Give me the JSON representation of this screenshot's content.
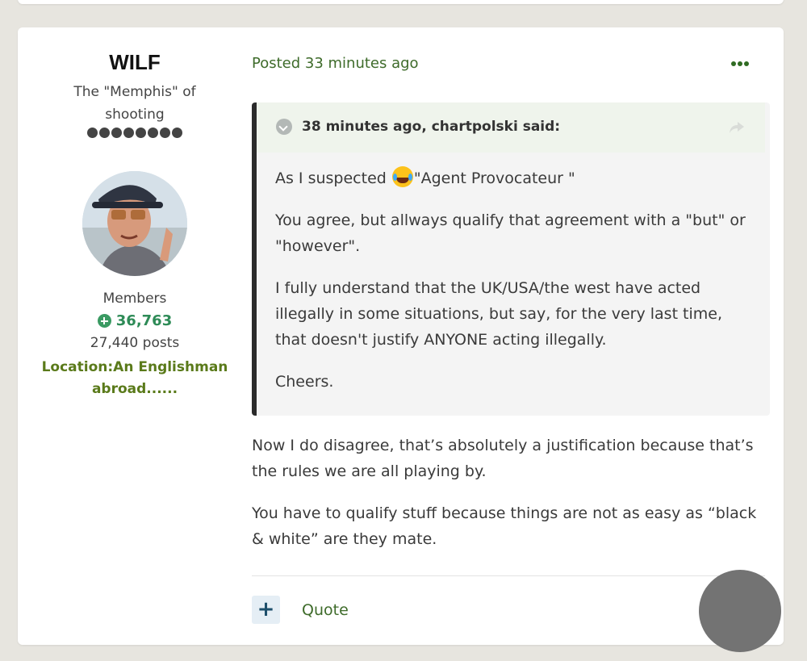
{
  "author": {
    "name": "WILF",
    "title": "The \"Memphis\" of shooting",
    "rank_dots": 8,
    "group": "Members",
    "reputation": "36,763",
    "post_count": "27,440 posts",
    "location": "Location:An Englishman abroad......"
  },
  "post": {
    "posted": "Posted 33 minutes ago",
    "quote": {
      "citation": "38 minutes ago, chartpolski said:",
      "para1_before": "As I suspected ",
      "para1_after": "\"Agent Provocateur \"",
      "para2": "You agree, but allways qualify that agreement with a \"but\" or \"however\".",
      "para3": "I fully understand that the UK/USA/the west have acted illegally in some situations, but say, for the very last time, that doesn't justify ANYONE  acting illegally.",
      "para4": "Cheers."
    },
    "body_para1": "Now I do disagree, that’s absolutely a justification because that’s the rules we are all playing by.",
    "body_para2": "You have to qualify stuff because things are not as easy as “black & white” are they mate.",
    "actions": {
      "plus_label": "+",
      "quote_label": "Quote"
    }
  },
  "icons": {
    "menu": "ellipsis-icon",
    "quote_toggle": "chevron-down-icon",
    "share": "share-arrow-icon",
    "reputation": "plus-circle-icon",
    "emoji": "tears-of-joy-emoji"
  },
  "colors": {
    "accent_green": "#3e6b2a",
    "reputation_green": "#2e8b57",
    "location_olive": "#5a7a1a",
    "background": "#e7e5df"
  }
}
